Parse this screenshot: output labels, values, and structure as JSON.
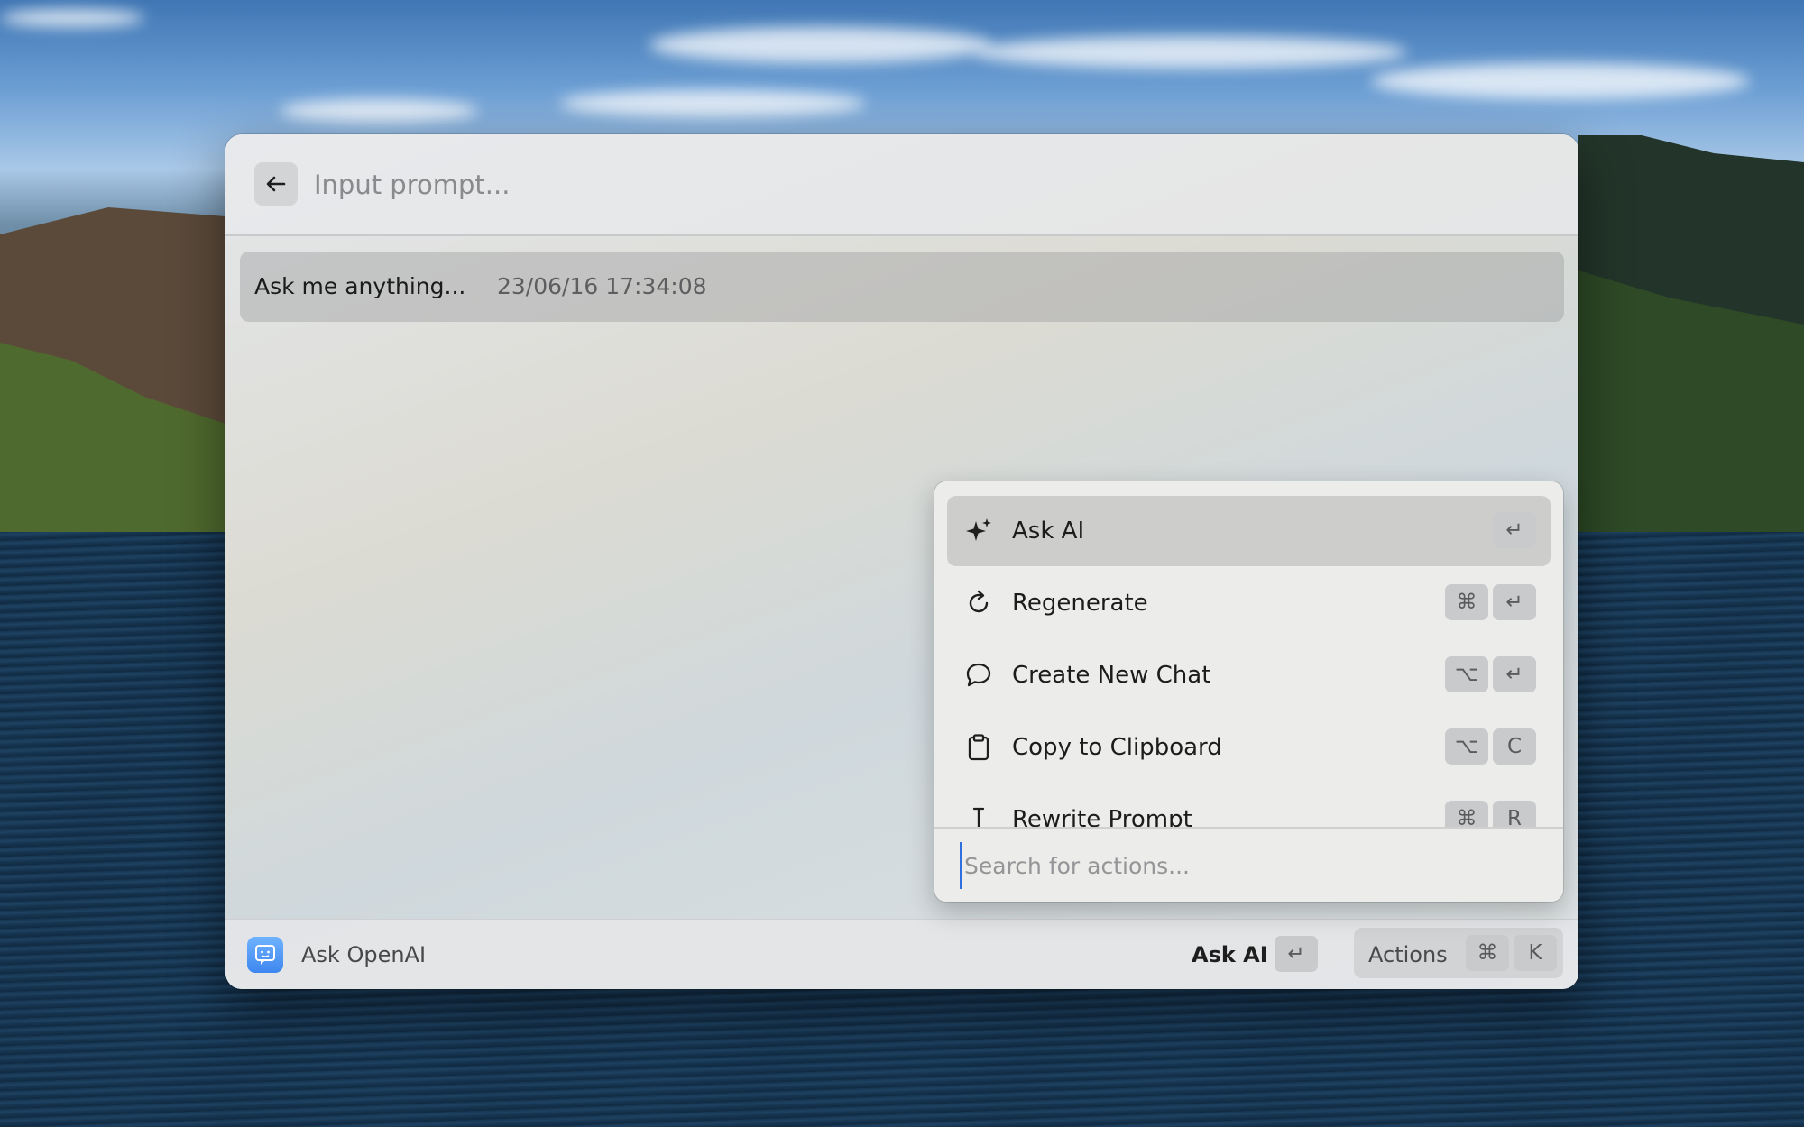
{
  "window": {
    "prompt_placeholder": "Input prompt...",
    "history": {
      "title": "Ask me anything...",
      "timestamp": "23/06/16 17:34:08"
    }
  },
  "menu": {
    "items": [
      {
        "label": "Ask AI",
        "icon": "sparkles-icon",
        "keys": [
          "↵"
        ],
        "selected": true
      },
      {
        "label": "Regenerate",
        "icon": "refresh-icon",
        "keys": [
          "⌘",
          "↵"
        ]
      },
      {
        "label": "Create New Chat",
        "icon": "speech-bubble-icon",
        "keys": [
          "⌥",
          "↵"
        ]
      },
      {
        "label": "Copy to Clipboard",
        "icon": "clipboard-icon",
        "keys": [
          "⌥",
          "C"
        ]
      },
      {
        "label": "Rewrite Prompt",
        "icon": "text-cursor-icon",
        "keys": [
          "⌘",
          "R"
        ]
      }
    ],
    "search_placeholder": "Search for actions..."
  },
  "footer": {
    "app_name": "Ask OpenAI",
    "primary_action": "Ask AI",
    "primary_key": "↵",
    "actions_label": "Actions",
    "actions_keys": [
      "⌘",
      "K"
    ]
  },
  "colors": {
    "accent": "#2f6fe0",
    "app_icon": "#4a8ff2"
  }
}
